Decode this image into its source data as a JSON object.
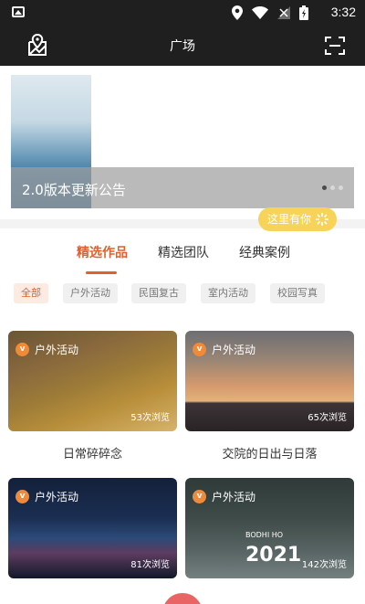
{
  "statusbar": {
    "time": "3:32"
  },
  "appbar": {
    "title": "广场"
  },
  "banner": {
    "caption": "2.0版本更新公告",
    "dots": 3,
    "active_dot": 0
  },
  "tip": {
    "label": "这里有你"
  },
  "tabs": [
    {
      "label": "精选作品",
      "active": true
    },
    {
      "label": "精选团队",
      "active": false
    },
    {
      "label": "经典案例",
      "active": false
    }
  ],
  "chips": [
    {
      "label": "全部",
      "active": true
    },
    {
      "label": "户外活动",
      "active": false
    },
    {
      "label": "民国复古",
      "active": false
    },
    {
      "label": "室内活动",
      "active": false
    },
    {
      "label": "校园写真",
      "active": false
    }
  ],
  "cards": [
    {
      "tag": "户外活动",
      "views": "53次浏览",
      "name": "日常碎碎念"
    },
    {
      "tag": "户外活动",
      "views": "65次浏览",
      "name": "交院的日出与日落"
    },
    {
      "tag": "户外活动",
      "views": "81次浏览",
      "name": ""
    },
    {
      "tag": "户外活动",
      "views": "142次浏览",
      "name": "",
      "overlay_text": "2021",
      "overlay_sub": "BODHI HO"
    }
  ],
  "colors": {
    "accent": "#e0612d",
    "tip": "#f7d35a",
    "bar": "#1f1f1f"
  }
}
